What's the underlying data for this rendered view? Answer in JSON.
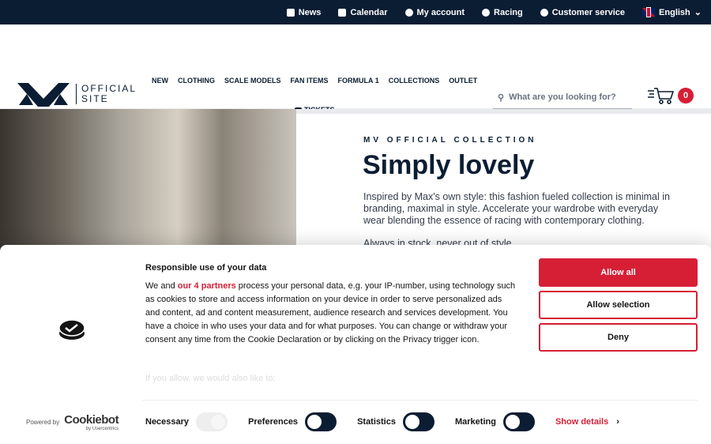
{
  "topbar": {
    "items": [
      {
        "label": "News",
        "icon": "newspaper-icon"
      },
      {
        "label": "Calendar",
        "icon": "calendar-icon"
      },
      {
        "label": "My account",
        "icon": "user-icon"
      },
      {
        "label": "Racing",
        "icon": "racing-icon"
      },
      {
        "label": "Customer service",
        "icon": "help-icon"
      }
    ],
    "language": "English"
  },
  "logo": {
    "line1": "OFFICIAL",
    "line2": "SITE"
  },
  "nav": {
    "items": [
      "NEW",
      "CLOTHING",
      "SCALE MODELS",
      "FAN ITEMS",
      "FORMULA 1",
      "COLLECTIONS",
      "OUTLET"
    ],
    "tickets": "TICKETS"
  },
  "search": {
    "placeholder": "What are you looking for?"
  },
  "cart": {
    "count": "0"
  },
  "hero": {
    "kicker": "MV OFFICIAL COLLECTION",
    "title": "Simply lovely",
    "description": "Inspired by Max's own style: this fashion fueled collection is minimal in branding, maximal in style. Accelerate your wardrobe with everyday wear blending the essence of racing with contemporary clothing.",
    "tagline": "Always in stock, never out of style"
  },
  "cookie": {
    "title": "Responsible use of your data",
    "text_before": "We and ",
    "partners_link": "our 4 partners",
    "text_after": " process your personal data, e.g. your IP-number, using technology such as cookies to store and access information on your device in order to serve personalized ads and content, ad and content measurement, audience research and services development. You have a choice in who uses your data and for what purposes. You can change or withdraw your consent any time from the Cookie Declaration or by clicking on the Privacy trigger icon.",
    "faded": "If you allow, we would also like to:",
    "buttons": {
      "allow_all": "Allow all",
      "allow_selection": "Allow selection",
      "deny": "Deny"
    },
    "powered_by": "Powered by",
    "brand": "Cookiebot",
    "brand_sub": "by Usercentrics",
    "toggles": [
      {
        "label": "Necessary",
        "on": true,
        "disabled": true
      },
      {
        "label": "Preferences",
        "on": false
      },
      {
        "label": "Statistics",
        "on": false
      },
      {
        "label": "Marketing",
        "on": false
      }
    ],
    "show_details": "Show details"
  },
  "colors": {
    "navy": "#0b1d33",
    "accent": "#d61f35"
  }
}
